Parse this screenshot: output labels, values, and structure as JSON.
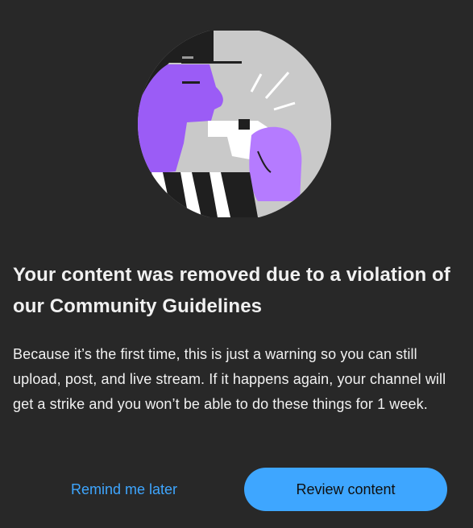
{
  "dialog": {
    "illustration_icon": "referee-whistle-illustration",
    "title": "Your content was removed due to a violation of our Community Guidelines",
    "body": "Because it’s the first time, this is just a warning so you can still upload, post, and live stream. If it happens again, your channel will get a strike and you won’t be able to do these things for 1 week.",
    "remind_label": "Remind me later",
    "review_label": "Review content"
  },
  "colors": {
    "background": "#282828",
    "text": "#f1f1f1",
    "accent": "#3ea6ff",
    "illustration_purple": "#9b5cf6",
    "illustration_gray": "#c8c8c8"
  }
}
